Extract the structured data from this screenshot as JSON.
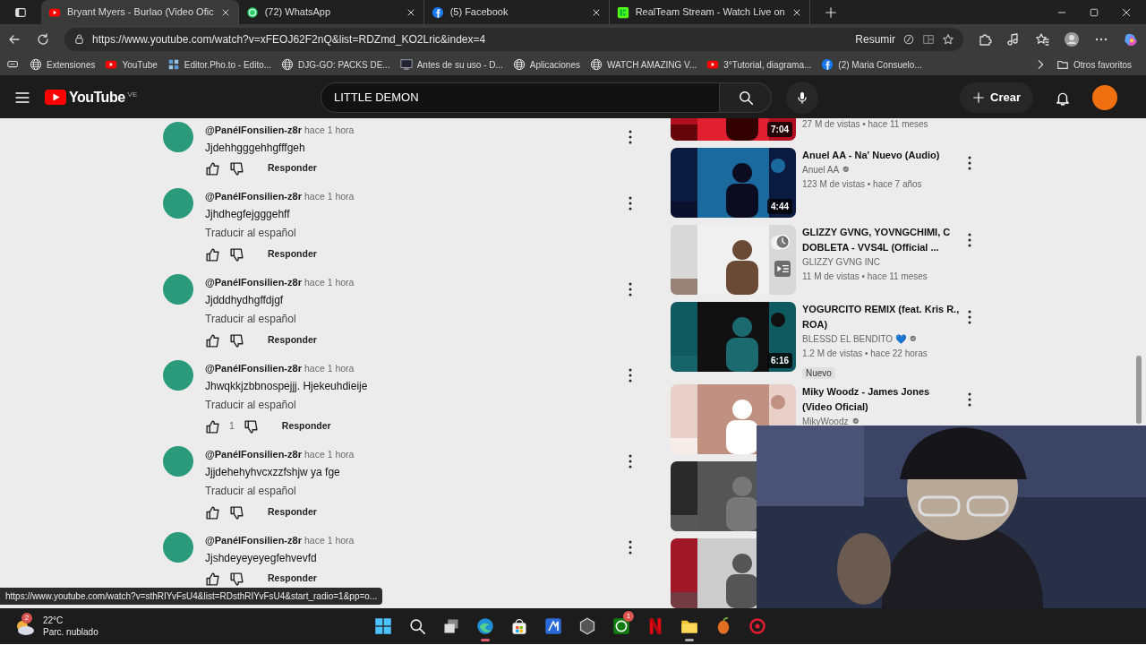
{
  "browser": {
    "tabs": [
      {
        "title": "Bryant Myers - Burlao (Video Ofic",
        "selected": true
      },
      {
        "title": "(72) WhatsApp",
        "selected": false
      },
      {
        "title": "(5) Facebook",
        "selected": false
      },
      {
        "title": "RealTeam Stream - Watch Live on",
        "selected": false
      }
    ],
    "url": "https://www.youtube.com/watch?v=xFEOJ62F2nQ&list=RDZmd_KO2Lric&index=4",
    "summary_button": "Resumir",
    "bookmarks": [
      {
        "label": "Extensiones"
      },
      {
        "label": "YouTube"
      },
      {
        "label": "Editor.Pho.to - Edito..."
      },
      {
        "label": "DJG-GO: PACKS DE..."
      },
      {
        "label": "Antes de su uso - D..."
      },
      {
        "label": "Aplicaciones"
      },
      {
        "label": "WATCH AMAZING V..."
      },
      {
        "label": "3°Tutorial, diagrama..."
      },
      {
        "label": "(2) Maria Consuelo..."
      }
    ],
    "other_bookmarks": "Otros favoritos"
  },
  "youtube": {
    "logo": "YouTube",
    "region": "VE",
    "search_value": "LITTLE DEMON",
    "create_button": "Crear"
  },
  "comments": [
    {
      "author": "@PanélFonsilien-z8r",
      "time": "hace 1 hora",
      "text": "Jjdehhgggehhgfffgeh",
      "reply": "Responder"
    },
    {
      "author": "@PanélFonsilien-z8r",
      "time": "hace 1 hora",
      "text": "Jjhdhegfejgggehff",
      "translate": "Traducir al español",
      "reply": "Responder"
    },
    {
      "author": "@PanélFonsilien-z8r",
      "time": "hace 1 hora",
      "text": "Jjdddhydhgffdjgf",
      "translate": "Traducir al español",
      "reply": "Responder"
    },
    {
      "author": "@PanélFonsilien-z8r",
      "time": "hace 1 hora",
      "text": "Jhwqkkjzbbnospejjj. Hjekeuhdieije",
      "translate": "Traducir al español",
      "likes": "1",
      "reply": "Responder"
    },
    {
      "author": "@PanélFonsilien-z8r",
      "time": "hace 1 hora",
      "text": "Jjjdehehyhvcxzzfshjw ya fge",
      "translate": "Traducir al español",
      "reply": "Responder"
    },
    {
      "author": "@PanélFonsilien-z8r",
      "time": "hace 1 hora",
      "text": "Jjshdeyeyeyegfehvevfd",
      "reply": "Responder"
    }
  ],
  "recommendations": [
    {
      "meta": "27 M de vistas • hace 11 meses",
      "duration": "7:04"
    },
    {
      "title": "Anuel AA - Na' Nuevo (Audio)",
      "channel": "Anuel AA",
      "verified": true,
      "meta": "123 M de vistas • hace 7 años",
      "duration": "4:44"
    },
    {
      "title": "GLIZZY GVNG, YOVNGCHIMI, C DOBLETA - VVS4L (Official ...",
      "channel": "GLIZZY GVNG INC",
      "verified": false,
      "meta": "11 M de vistas • hace 11 meses",
      "hover": true
    },
    {
      "title": "YOGURCITO REMIX (feat. Kris R., ROA)",
      "channel": "BLESSD EL BENDITO 💙",
      "verified": true,
      "meta": "1.2 M de vistas • hace 22 horas",
      "badge": "Nuevo",
      "duration": "6:16"
    },
    {
      "title": "Miky Woodz - James Jones (Video Oficial)",
      "channel": "MikyWoodz",
      "verified": true
    },
    {
      "kind": "covered"
    },
    {
      "kind": "covered"
    }
  ],
  "status_url": "https://www.youtube.com/watch?v=sthRIYvFsU4&list=RDsthRIYvFsU4&start_radio=1&pp=o...",
  "taskbar": {
    "weather": {
      "temperature": "22°C",
      "condition": "Parc. nublado",
      "badge": "2"
    },
    "apps": [
      {
        "kind": "start",
        "running": false
      },
      {
        "kind": "search",
        "running": false
      },
      {
        "kind": "taskview",
        "running": false
      },
      {
        "kind": "edge",
        "running": true
      },
      {
        "kind": "store",
        "running": false
      },
      {
        "kind": "bluetile",
        "running": false
      },
      {
        "kind": "cube",
        "running": false
      },
      {
        "kind": "xbox",
        "running": false,
        "badge": "1"
      },
      {
        "kind": "netflix",
        "running": false
      },
      {
        "kind": "folder",
        "running": true
      },
      {
        "kind": "fruit",
        "running": false
      },
      {
        "kind": "redring",
        "running": false
      }
    ]
  }
}
